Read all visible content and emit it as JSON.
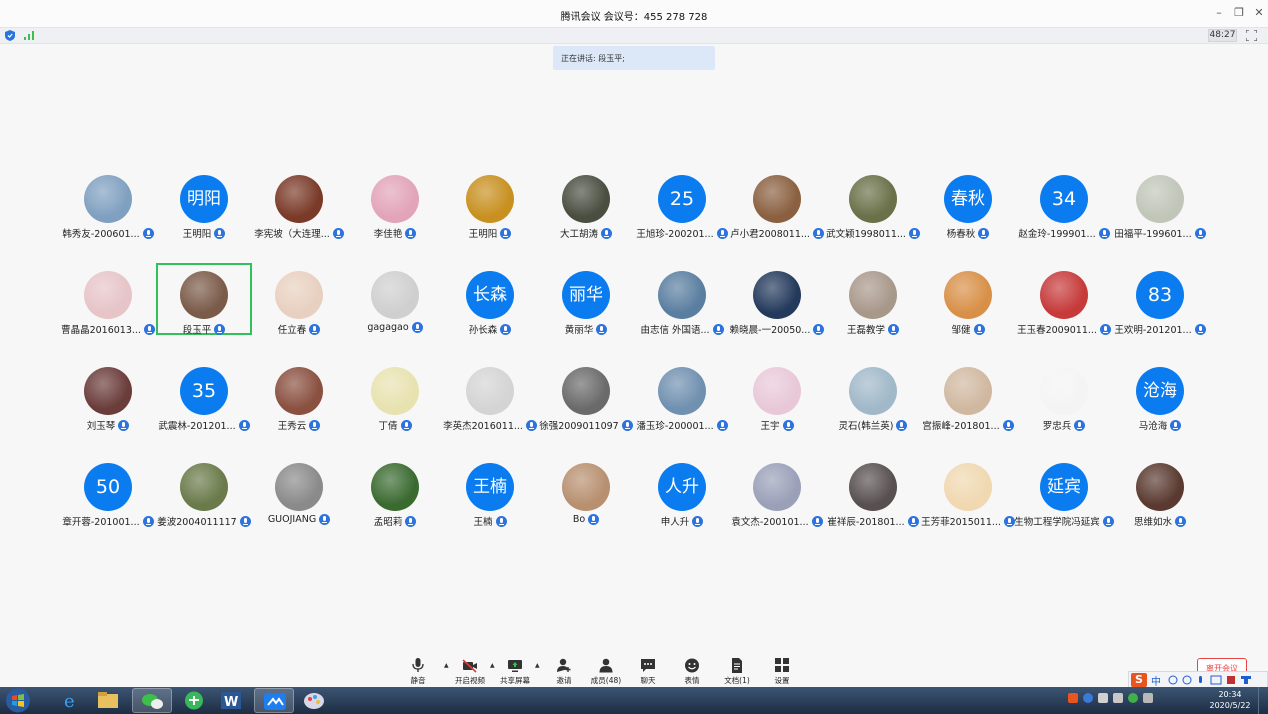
{
  "window": {
    "title": "腾讯会议 会议号：455 278 728"
  },
  "status": {
    "timer": "48:27"
  },
  "speaking": {
    "label": "正在讲话: 段玉平;"
  },
  "participants": [
    {
      "name": "韩秀友-200601...",
      "photo": "#7fa0c0"
    },
    {
      "name": "王明阳",
      "avatar_text": "明阳"
    },
    {
      "name": "李宪坡（大连理...",
      "photo": "#7a3a28"
    },
    {
      "name": "李佳艳",
      "photo": "#e2a4b8"
    },
    {
      "name": "王明阳",
      "photo": "#c89020"
    },
    {
      "name": "大工胡涛",
      "photo": "#4a4e40"
    },
    {
      "name": "王旭珍-200201...",
      "avatar_text": "25"
    },
    {
      "name": "卢小君2008011...",
      "photo": "#8a6040"
    },
    {
      "name": "武文颖1998011...",
      "photo": "#6a7048"
    },
    {
      "name": "杨春秋",
      "avatar_text": "春秋"
    },
    {
      "name": "赵金玲-199901...",
      "avatar_text": "34"
    },
    {
      "name": "田福平-199601...",
      "photo": "#c0c6b8"
    },
    {
      "name": "曹晶晶2016013...",
      "photo": "#e6c4c8"
    },
    {
      "name": "段玉平",
      "photo": "#7a5a48"
    },
    {
      "name": "任立春",
      "photo": "#e8d0c0"
    },
    {
      "name": "gagagao",
      "photo": "#cfcfcf"
    },
    {
      "name": "孙长森",
      "avatar_text": "长森"
    },
    {
      "name": "黄丽华",
      "avatar_text": "丽华"
    },
    {
      "name": "由志信 外国语...",
      "photo": "#5a7ea0"
    },
    {
      "name": "赖晓晨-一20050...",
      "photo": "#243a5c"
    },
    {
      "name": "王磊教学",
      "photo": "#a8988a"
    },
    {
      "name": "邹健",
      "photo": "#d89048"
    },
    {
      "name": "王玉春2009011...",
      "photo": "#c63a3a"
    },
    {
      "name": "王欢明-201201...",
      "avatar_text": "83"
    },
    {
      "name": "刘玉琴",
      "photo": "#6a3c3a"
    },
    {
      "name": "武震林-201201...",
      "avatar_text": "35"
    },
    {
      "name": "王秀云",
      "photo": "#8a5040"
    },
    {
      "name": "丁倩",
      "photo": "#e8e2b0"
    },
    {
      "name": "李英杰2016011...",
      "photo": "#d4d4d4"
    },
    {
      "name": "徐强2009011097",
      "photo": "#6a6a6a"
    },
    {
      "name": "潘玉珍-200001...",
      "photo": "#7090b0"
    },
    {
      "name": "王宇",
      "photo": "#e8c8d8"
    },
    {
      "name": "灵石(韩兰英)",
      "photo": "#a0b8c8"
    },
    {
      "name": "宫振峰-201801...",
      "photo": "#d0b8a0"
    },
    {
      "name": "罗忠兵",
      "photo": "#f4f4f4"
    },
    {
      "name": "马沧海",
      "avatar_text": "沧海"
    },
    {
      "name": "章开蓉-201001...",
      "avatar_text": "50"
    },
    {
      "name": "姜波2004011117",
      "photo": "#6a7a4a"
    },
    {
      "name": "GUOJIANG",
      "photo": "#8a8a8a"
    },
    {
      "name": "孟昭莉",
      "photo": "#3a6a30"
    },
    {
      "name": "王楠",
      "avatar_text": "王楠"
    },
    {
      "name": "Bo",
      "photo": "#b89070"
    },
    {
      "name": "申人升",
      "avatar_text": "人升"
    },
    {
      "name": "袁文杰-200101...",
      "photo": "#9aa0b8"
    },
    {
      "name": "崔祥辰-201801...",
      "photo": "#585050"
    },
    {
      "name": "王芳菲2015011...",
      "photo": "#f0d8b0"
    },
    {
      "name": "生物工程学院冯延宾",
      "avatar_text": "延宾"
    },
    {
      "name": "思维如水",
      "photo": "#5a3a30"
    }
  ],
  "toolbar": {
    "mute": "静音",
    "video": "开启视频",
    "share": "共享屏幕",
    "invite": "邀请",
    "members": "成员(48)",
    "chat": "聊天",
    "emoji": "表情",
    "docs": "文档(1)",
    "settings": "设置"
  },
  "leave": "离开会议",
  "ime": {
    "logo": "S",
    "mode": "中"
  },
  "clock": {
    "time": "20:34",
    "date": "2020/5/22"
  },
  "colors": {
    "accent": "#0a7cf0",
    "active_border": "#32c05a",
    "leave_red": "#e84545"
  }
}
